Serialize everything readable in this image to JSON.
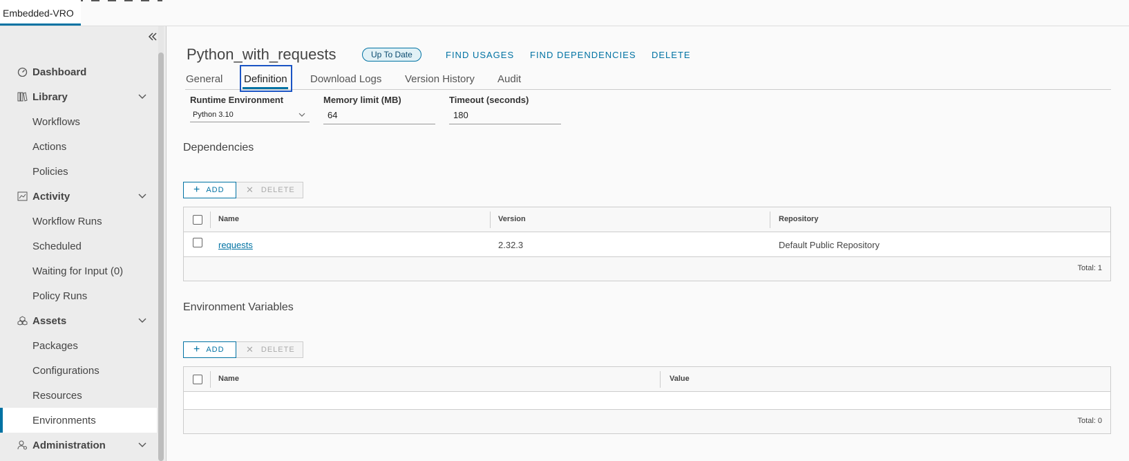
{
  "window": {
    "tab_title": "Embedded-VRO"
  },
  "sidebar": {
    "collapse_icon": "double-chevron-left",
    "items": [
      {
        "label": "Dashboard",
        "type": "top",
        "icon": "gauge-icon"
      },
      {
        "label": "Library",
        "type": "top",
        "icon": "books-icon",
        "expandable": true
      },
      {
        "label": "Workflows",
        "type": "sub"
      },
      {
        "label": "Actions",
        "type": "sub"
      },
      {
        "label": "Policies",
        "type": "sub"
      },
      {
        "label": "Activity",
        "type": "top",
        "icon": "chart-icon",
        "expandable": true
      },
      {
        "label": "Workflow Runs",
        "type": "sub"
      },
      {
        "label": "Scheduled",
        "type": "sub"
      },
      {
        "label": "Waiting for Input (0)",
        "type": "sub"
      },
      {
        "label": "Policy Runs",
        "type": "sub"
      },
      {
        "label": "Assets",
        "type": "top",
        "icon": "boxes-icon",
        "expandable": true
      },
      {
        "label": "Packages",
        "type": "sub"
      },
      {
        "label": "Configurations",
        "type": "sub"
      },
      {
        "label": "Resources",
        "type": "sub"
      },
      {
        "label": "Environments",
        "type": "sub",
        "active": true
      },
      {
        "label": "Administration",
        "type": "top",
        "icon": "user-gear-icon",
        "expandable": true
      }
    ]
  },
  "header": {
    "title": "Python_with_requests",
    "status_badge": "Up To Date",
    "actions": {
      "find_usages": "FIND USAGES",
      "find_dependencies": "FIND DEPENDENCIES",
      "delete": "DELETE"
    }
  },
  "tabs": {
    "general": "General",
    "definition": "Definition",
    "download_logs": "Download Logs",
    "version_history": "Version History",
    "audit": "Audit",
    "active": "Definition"
  },
  "form": {
    "runtime_label": "Runtime Environment",
    "runtime_value": "Python 3.10",
    "memory_label": "Memory limit (MB)",
    "memory_value": "64",
    "timeout_label": "Timeout (seconds)",
    "timeout_value": "180"
  },
  "dependencies": {
    "title": "Dependencies",
    "add_label": "ADD",
    "delete_label": "DELETE",
    "columns": {
      "name": "Name",
      "version": "Version",
      "repository": "Repository"
    },
    "rows": [
      {
        "name": "requests",
        "version": "2.32.3",
        "repository": "Default Public Repository"
      }
    ],
    "total": "Total: 1"
  },
  "env_vars": {
    "title": "Environment Variables",
    "add_label": "ADD",
    "delete_label": "DELETE",
    "columns": {
      "name": "Name",
      "value": "Value"
    },
    "total": "Total: 0"
  },
  "colors": {
    "accent": "#0072a3",
    "badge_bg": "#e1f1f6",
    "sidebar_bg": "#ececec"
  }
}
